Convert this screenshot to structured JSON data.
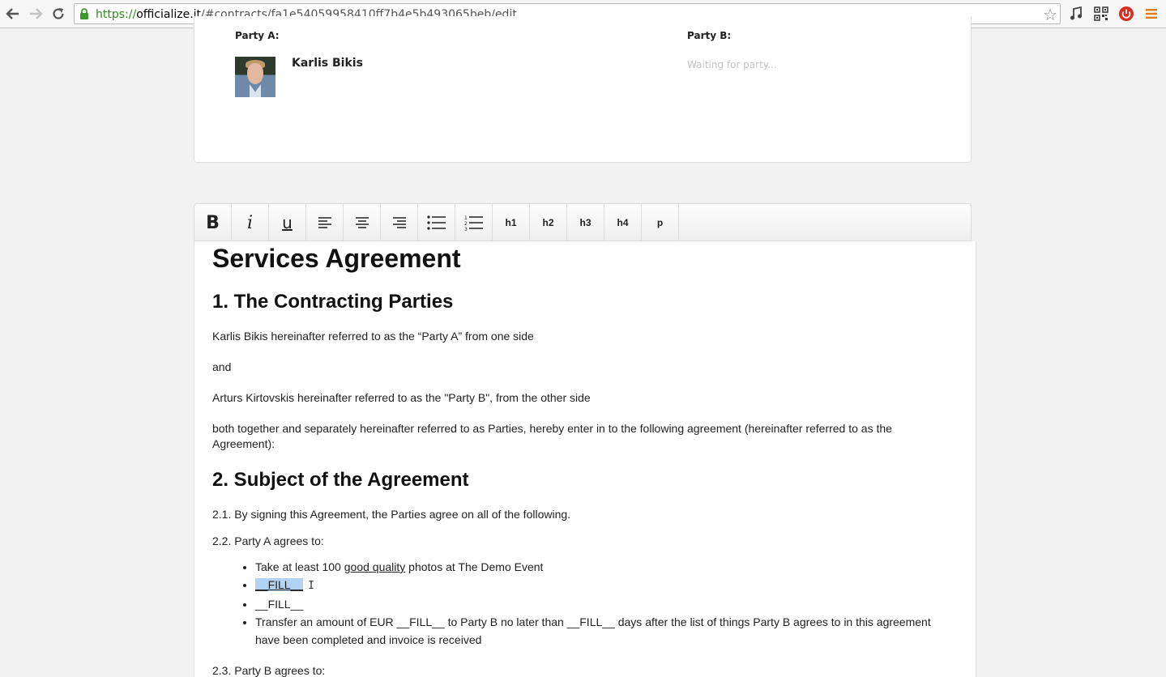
{
  "browser": {
    "url_scheme": "https://",
    "url_host": "officialize.it",
    "url_path": "/#contracts/fa1e54059958410ff7b4e5b493065beb/edit",
    "back_icon": "back-arrow-icon",
    "forward_icon": "forward-arrow-icon",
    "reload_icon": "reload-icon",
    "extensions": [
      "music-note-icon",
      "qr-code-icon",
      "power-icon",
      "menu-icon"
    ]
  },
  "parties": {
    "party_a_label": "Party A:",
    "party_b_label": "Party B:",
    "party_a_name": "Karlis Bikis",
    "party_b_status": "Waiting for party..."
  },
  "toolbar": {
    "bold": "B",
    "italic": "i",
    "underline": "u",
    "h1": "h1",
    "h2": "h2",
    "h3": "h3",
    "h4": "h4",
    "p": "p"
  },
  "document": {
    "title": "Services Agreement",
    "section1_heading": "1. The Contracting Parties",
    "party_a_line": "Karlis Bikis hereinafter referred to as the “Party A” from one side",
    "and": "and",
    "party_b_line": "Arturs Kirtovskis hereinafter referred to as the \"Party B\", from the other side",
    "together_line": "both together and separately hereinafter referred to as Parties, hereby enter in to the following agreement (hereinafter referred to as the Agreement):",
    "section2_heading": "2. Subject of the Agreement",
    "clause_2_1": "2.1. By signing this Agreement, the Parties agree on all of the following.",
    "clause_2_2": "2.2. Party A agrees to:",
    "item1_pre": "Take at least 100 ",
    "item1_underlined": "good quality",
    "item1_post": " photos at The Demo Event",
    "item2": "__FILL__",
    "item3": "__FILL__",
    "item4": "Transfer an amount of EUR __FILL__ to Party B no later than __FILL__ days after the list of things Party B agrees to in this agreement have been completed and invoice is received",
    "clause_2_3": "2.3. Party B agrees to:"
  }
}
